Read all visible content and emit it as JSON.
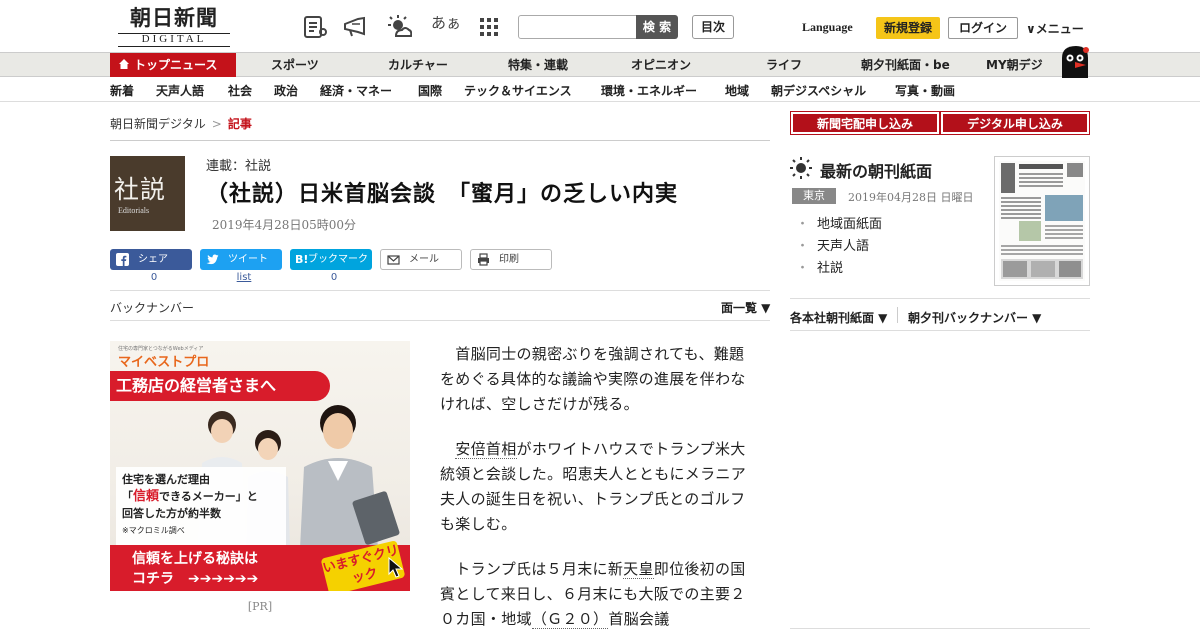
{
  "header": {
    "logo_main": "朝日新聞",
    "logo_sub": "DIGITAL",
    "icons": [
      "news-list-icon",
      "megaphone-icon",
      "weather-icon",
      "font-size-icon",
      "apps-grid-icon"
    ],
    "font_size_label": "あぁ",
    "search_placeholder": "",
    "search_button": "検 索",
    "mokuji_button": "目次",
    "language_link": "Language",
    "register_button": "新規登録",
    "login_button": "ログイン",
    "menu_button": "∨メニュー"
  },
  "nav_primary": {
    "items": [
      "トップニュース",
      "スポーツ",
      "カルチャー",
      "特集・連載",
      "オピニオン",
      "ライフ",
      "朝夕刊紙面・be",
      "MY朝デジ"
    ]
  },
  "nav_secondary": {
    "items": [
      "新着",
      "天声人語",
      "社会",
      "政治",
      "経済・マネー",
      "国際",
      "テック＆サイエンス",
      "環境・エネルギー",
      "地域",
      "朝デジスペシャル",
      "写真・動画"
    ]
  },
  "breadcrumb": {
    "home": "朝日新聞デジタル",
    "separator": ">",
    "current": "記事"
  },
  "article": {
    "badge_kanji": "社説",
    "badge_en": "Editorials",
    "series": "連載：社説",
    "title": "（社説）日米首脳会談　「蜜月」の乏しい内実",
    "date": "2019年4月28日05時00分",
    "paragraphs": [
      {
        "text": "　首脳同士の親密ぶりを強調されても、難題をめぐる具体的な議論や実際の進展を伴わなければ、空しさだけが残る。"
      },
      {
        "pre": "　",
        "link1": "安倍首相",
        "post": "がホワイトハウスでトランプ米大統領と会談した。昭恵夫人とともにメラニア夫人の誕生日を祝い、トランプ氏とのゴルフも楽しむ。"
      },
      {
        "pre": "　トランプ氏は５月末に新",
        "link1": "天皇",
        "mid": "即位後初の国賓として来日し、６月末にも大阪での主要２０カ国・地域",
        "link2": "（Ｇ２０）",
        "post": "首脳会議"
      }
    ]
  },
  "share": {
    "facebook_label": "シェア",
    "facebook_count": "0",
    "twitter_label": "ツイート",
    "twitter_count": "list",
    "hatena_label": "ブックマーク",
    "hatena_prefix": "B!",
    "hatena_count": "0",
    "mail_label": "メール",
    "print_label": "印刷",
    "colors": {
      "facebook": "#3b5a9a",
      "twitter": "#1da1f2",
      "hatena": "#00a4de"
    }
  },
  "backnumber": {
    "label": "バックナンバー",
    "menlist": "面一覧 ▼"
  },
  "ad": {
    "brand_sub": "住宅の専門家とつながるWebメディア",
    "brand": "マイベストプロ",
    "headline": "工務店の経営者さまへ",
    "copy_l1": "住宅を選んだ理由",
    "copy_l2a": "「",
    "copy_l2_red": "信頼",
    "copy_l2b": "できるメーカー」と",
    "copy_l3": "回答した方が約半数",
    "copy_note": "※マクロミル調べ",
    "cta_l1": "信頼を上げる秘訣は",
    "cta_l2": "コチラ　➔➔➔➔➔➔",
    "cta_click": "いますぐクリック",
    "pr_label": "[PR]"
  },
  "sidebar": {
    "subscribe_paper": "新聞宅配申し込み",
    "subscribe_digital": "デジタル申し込み",
    "latest_title": "最新の朝刊紙面",
    "region_tag": "東京",
    "paper_date": "2019年04月28日 日曜日",
    "links": [
      "地域面紙面",
      "天声人語",
      "社説"
    ],
    "honsha": "各本社朝刊紙面 ▼",
    "yukan": "朝夕刊バックナンバー ▼",
    "accent": "#b3101a"
  }
}
